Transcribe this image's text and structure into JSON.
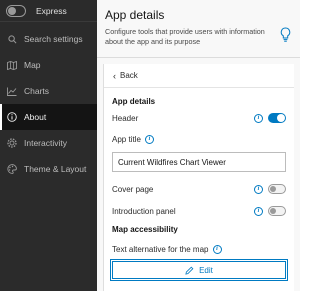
{
  "sidebar": {
    "toggle_label": "Express",
    "items": [
      {
        "label": "Search settings",
        "icon": "search-icon"
      },
      {
        "label": "Map",
        "icon": "map-icon"
      },
      {
        "label": "Charts",
        "icon": "chart-icon"
      },
      {
        "label": "About",
        "icon": "info-icon",
        "active": true
      },
      {
        "label": "Interactivity",
        "icon": "gear-icon"
      },
      {
        "label": "Theme & Layout",
        "icon": "palette-icon"
      }
    ]
  },
  "header": {
    "title": "App details",
    "description": "Configure tools that provide users with information about the app and its purpose"
  },
  "panel": {
    "back_label": "Back",
    "section_app_details": "App details",
    "header_label": "Header",
    "header_enabled": true,
    "app_title_label": "App title",
    "app_title_value": "Current Wildfires Chart Viewer",
    "cover_page_label": "Cover page",
    "cover_page_enabled": false,
    "intro_panel_label": "Introduction panel",
    "intro_panel_enabled": false,
    "section_map_accessibility": "Map accessibility",
    "text_alt_label": "Text alternative for the map",
    "edit_label": "Edit"
  },
  "colors": {
    "sidebar_bg": "#2b2b2b",
    "accent": "#007ac2"
  }
}
